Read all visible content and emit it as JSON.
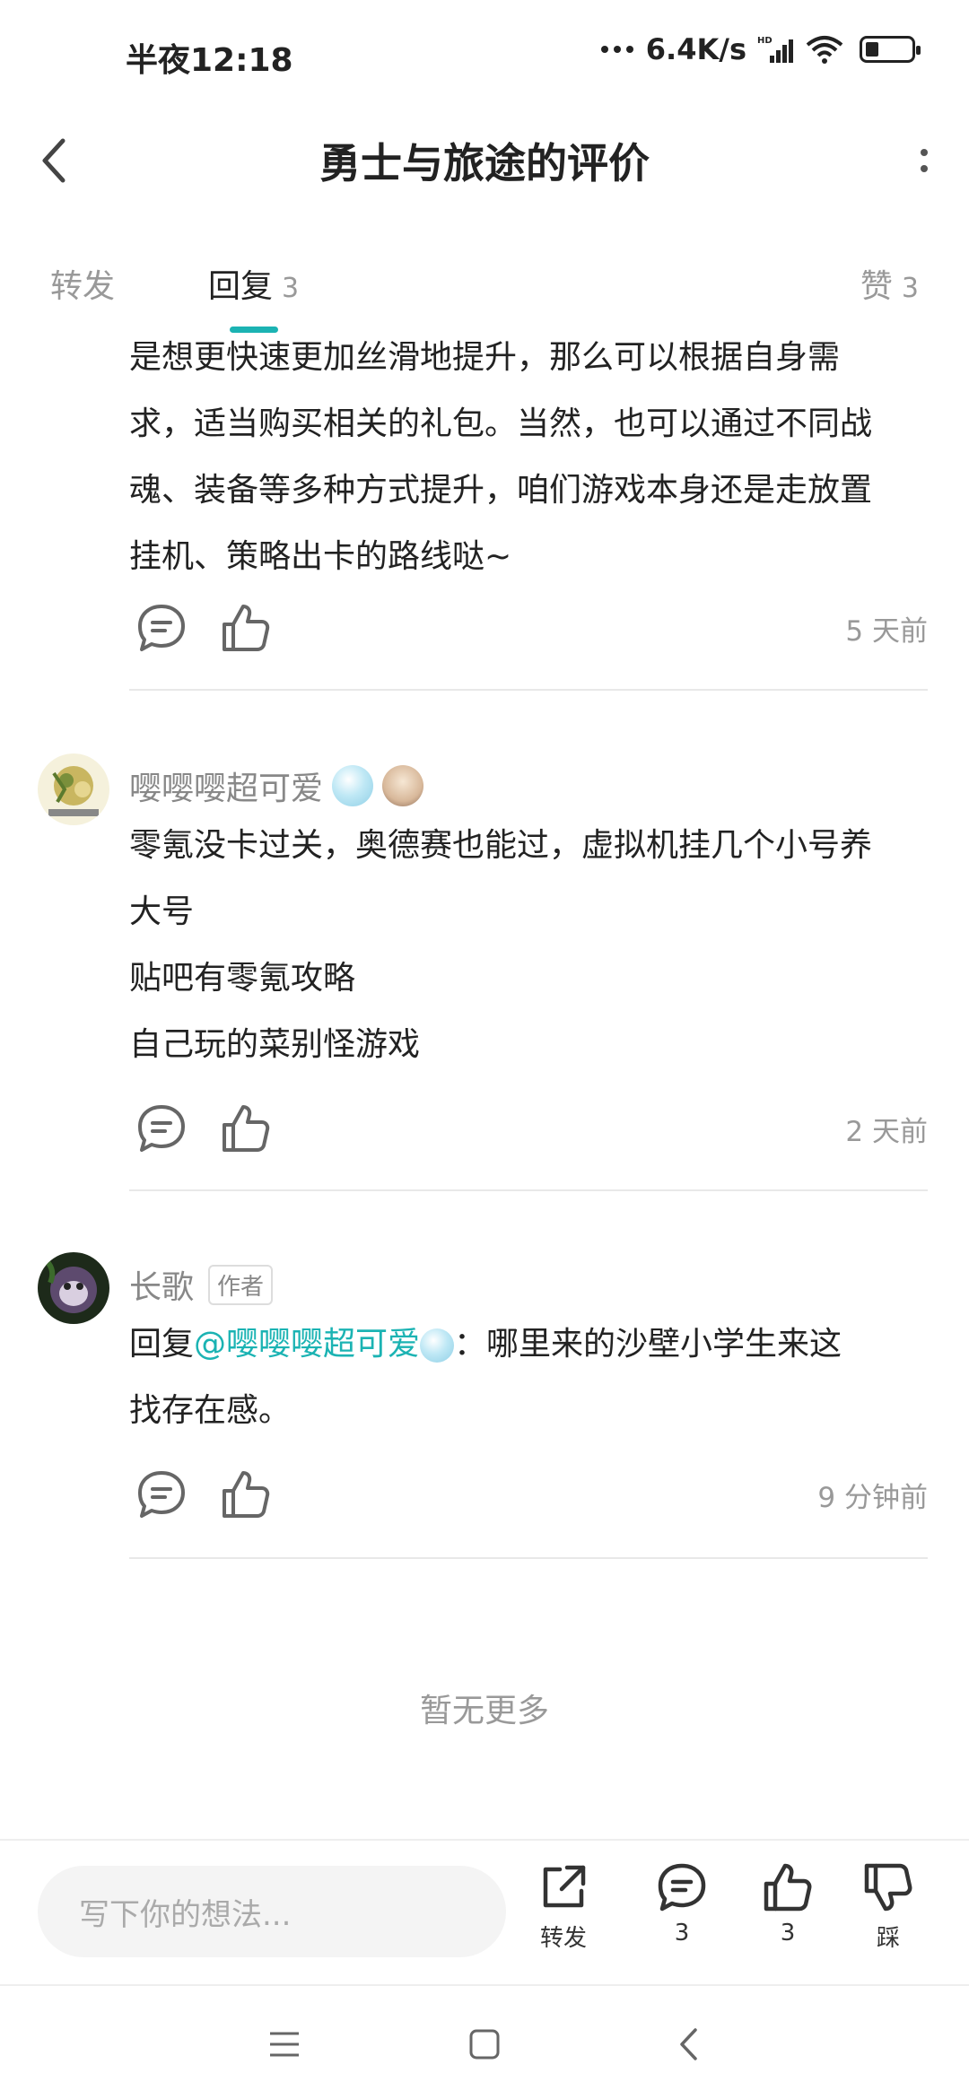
{
  "status_bar": {
    "time": "半夜12:18",
    "net_speed": "6.4K/s",
    "hd_label": "HD"
  },
  "header": {
    "title": "勇士与旅途的评价",
    "back_icon": "chevron-left-icon",
    "more_icon": "more-vertical-icon"
  },
  "tabs": {
    "forward_label": "转发",
    "reply_label": "回复",
    "reply_count": "3",
    "like_label": "赞",
    "like_count": "3"
  },
  "first_reply": {
    "lines": [
      "是想更快速更加丝滑地提升，那么可以根据自身需",
      "求，适当购买相关的礼包。当然，也可以通过不同战",
      "魂、装备等多种方式提升，咱们游戏本身还是走放置",
      "挂机、策略出卡的路线哒~"
    ],
    "time": "5 天前"
  },
  "comments": [
    {
      "username": "嘤嘤嘤超可爱",
      "lines": [
        "零氪没卡过关，奥德赛也能过，虚拟机挂几个小号养",
        "大号",
        "贴吧有零氪攻略",
        "自己玩的菜别怪游戏"
      ],
      "time": "2 天前"
    },
    {
      "username": "长歌",
      "author_tag": "作者",
      "reply_prefix": "回复",
      "mention": "@嘤嘤嘤超可爱",
      "reply_text_1": "：哪里来的沙壁小学生来这",
      "reply_text_2": "找存在感。",
      "time": "9 分钟前"
    }
  ],
  "no_more": "暂无更多",
  "bottom_bar": {
    "input_placeholder": "写下你的想法...",
    "forward_label": "转发",
    "comment_count": "3",
    "like_count": "3",
    "dislike_label": "踩"
  },
  "colors": {
    "accent": "#1bb3b3",
    "text_primary": "#222222",
    "text_secondary": "#999999",
    "divider": "#e8e8e8"
  }
}
